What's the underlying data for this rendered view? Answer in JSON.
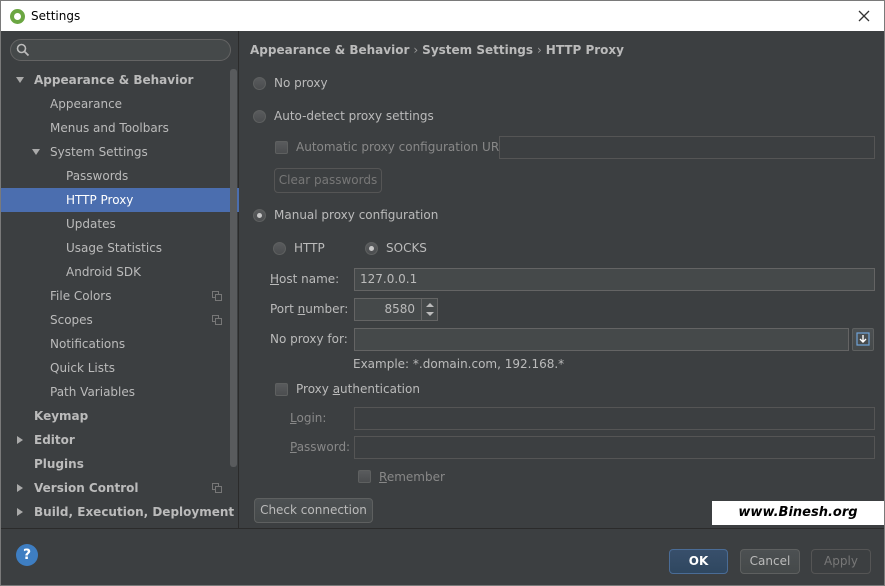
{
  "window": {
    "title": "Settings"
  },
  "search": {
    "placeholder": ""
  },
  "tree": [
    {
      "label": "Appearance & Behavior",
      "bold": true,
      "arrow": "down"
    },
    {
      "label": "Appearance"
    },
    {
      "label": "Menus and Toolbars"
    },
    {
      "label": "System Settings",
      "arrow": "down"
    },
    {
      "label": "Passwords"
    },
    {
      "label": "HTTP Proxy",
      "selected": true
    },
    {
      "label": "Updates"
    },
    {
      "label": "Usage Statistics"
    },
    {
      "label": "Android SDK"
    },
    {
      "label": "File Colors",
      "copy": true
    },
    {
      "label": "Scopes",
      "copy": true
    },
    {
      "label": "Notifications"
    },
    {
      "label": "Quick Lists"
    },
    {
      "label": "Path Variables"
    },
    {
      "label": "Keymap",
      "bold": true
    },
    {
      "label": "Editor",
      "bold": true,
      "arrow": "right"
    },
    {
      "label": "Plugins",
      "bold": true
    },
    {
      "label": "Version Control",
      "bold": true,
      "arrow": "right",
      "copy": true
    },
    {
      "label": "Build, Execution, Deployment",
      "bold": true,
      "arrow": "right"
    }
  ],
  "breadcrumb": [
    "Appearance & Behavior",
    "System Settings",
    "HTTP Proxy"
  ],
  "proxy": {
    "no_proxy": "No proxy",
    "auto_detect": "Auto-detect proxy settings",
    "auto_config_url": "Automatic proxy configuration URL:",
    "auto_config_url_value": "",
    "clear_passwords": "Clear passwords",
    "manual": "Manual proxy configuration",
    "selected_mode": "manual",
    "http": "HTTP",
    "socks": "SOCKS",
    "selected_protocol": "socks",
    "host_label_u": "H",
    "host_label_rest": "ost name:",
    "host_value": "127.0.0.1",
    "port_label_pre": "Port ",
    "port_label_u": "n",
    "port_label_rest": "umber:",
    "port_value": "8580",
    "no_proxy_for": "No proxy for:",
    "no_proxy_for_value": "",
    "example": "Example: *.domain.com, 192.168.*",
    "proxy_auth_pre": "Proxy ",
    "proxy_auth_u": "a",
    "proxy_auth_rest": "uthentication",
    "login_u": "L",
    "login_rest": "ogin:",
    "login_value": "",
    "password_u": "P",
    "password_rest": "assword:",
    "password_value": "",
    "remember_u": "R",
    "remember_rest": "emember",
    "check_connection": "Check connection"
  },
  "footer": {
    "help": "?",
    "ok": "OK",
    "cancel": "Cancel",
    "apply": "Apply"
  },
  "watermark": "www.Binesh.org",
  "colors": {
    "selection": "#4b6eaf",
    "background": "#3c3f41",
    "help": "#3e7ec2"
  }
}
